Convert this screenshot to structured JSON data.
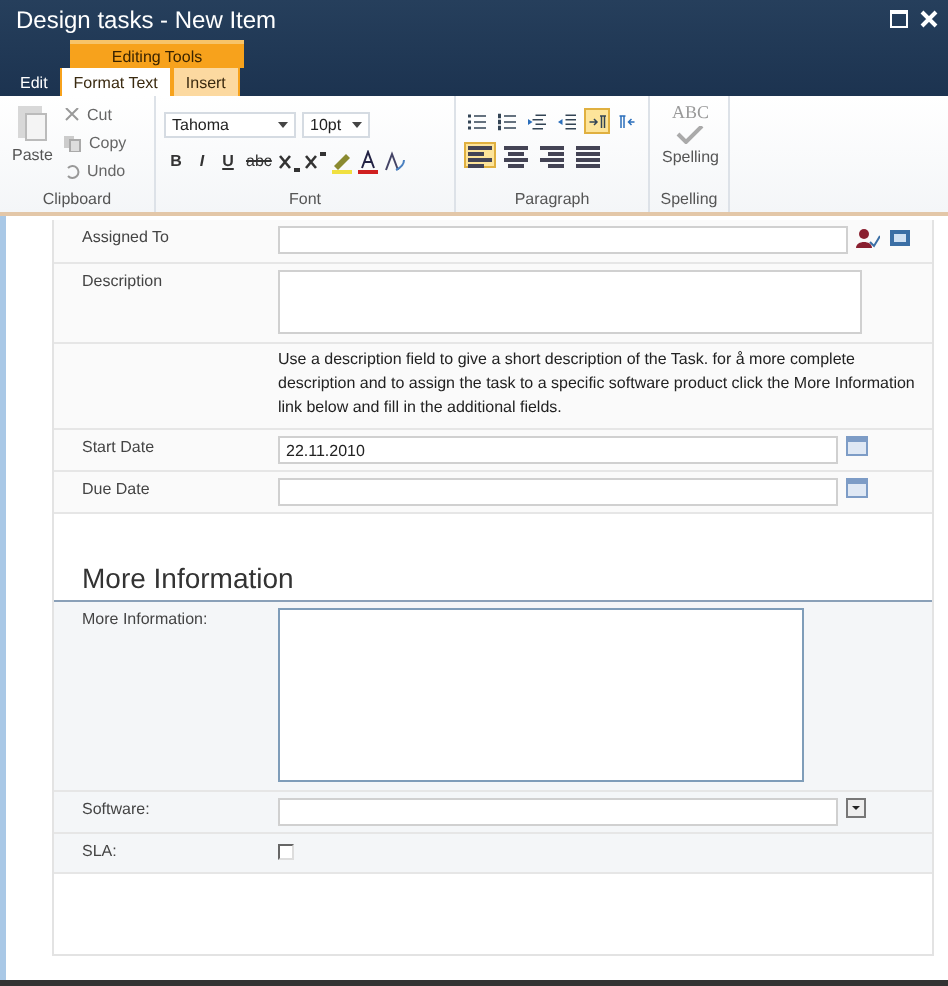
{
  "window": {
    "title": "Design tasks - New Item"
  },
  "context_label": "Editing Tools",
  "tabs": [
    {
      "label": "Edit",
      "selected": false,
      "contextual": false
    },
    {
      "label": "Format Text",
      "selected": true,
      "contextual": true
    },
    {
      "label": "Insert",
      "selected": false,
      "contextual": true
    }
  ],
  "ribbon": {
    "clipboard": {
      "label": "Clipboard",
      "paste": "Paste",
      "cut": "Cut",
      "copy": "Copy",
      "undo": "Undo"
    },
    "font": {
      "label": "Font",
      "face": "Tahoma",
      "size": "10pt",
      "bold": "B",
      "italic": "I",
      "underline": "U",
      "strike": "abc"
    },
    "paragraph": {
      "label": "Paragraph",
      "buttons": [
        {
          "selected": false
        },
        {
          "selected": false
        },
        {
          "selected": false
        },
        {
          "selected": false
        },
        {
          "selected": true
        },
        {
          "selected": false
        }
      ],
      "alignment": [
        {
          "selected": true
        },
        {
          "selected": false
        },
        {
          "selected": false
        },
        {
          "selected": false
        }
      ]
    },
    "spelling": {
      "label": "Spelling",
      "button": "Spelling",
      "icon_text": "ABC"
    }
  },
  "form": {
    "rows": [
      {
        "kind": "people",
        "label": "Assigned To"
      },
      {
        "kind": "textarea",
        "label": "Description"
      },
      {
        "kind": "help",
        "text": "Use a description field to give a short description of the Task. for å more complete description and to assign the task to a specific software product click the More Information link below and fill in the additional fields."
      },
      {
        "kind": "date",
        "label": "Start Date",
        "value": "22.11.2010"
      },
      {
        "kind": "date",
        "label": "Due Date",
        "value": ""
      }
    ],
    "section": {
      "title": "More Information",
      "rows": [
        {
          "kind": "bigtext",
          "label": "More Information:"
        },
        {
          "kind": "select",
          "label": "Software:"
        },
        {
          "kind": "checkbox",
          "label": "SLA:",
          "checked": false
        }
      ]
    }
  }
}
